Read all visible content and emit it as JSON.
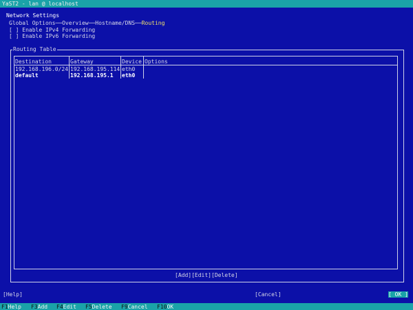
{
  "window": {
    "title": "YaST2 - lan @ localhost"
  },
  "dialog": {
    "title": "Network Settings",
    "tabs": [
      "Global Options",
      "Overview",
      "Hostname/DNS",
      "Routing"
    ],
    "tab_separators": [
      "──",
      "──",
      "──"
    ],
    "active_tab": "Routing"
  },
  "checkboxes": [
    {
      "mark": "[ ]",
      "label": "Enable IPv4 Forwarding",
      "checked": false
    },
    {
      "mark": "[ ]",
      "label": "Enable IPv6 Forwarding",
      "checked": false
    }
  ],
  "routing_table": {
    "title": "Routing Table",
    "columns": [
      "Destination",
      "Gateway",
      "Device",
      "Options"
    ],
    "rows": [
      {
        "destination": "192.168.196.0/24",
        "gateway": "192.168.195.114",
        "device": "eth0",
        "options": ""
      },
      {
        "destination": "default",
        "gateway": "192.168.195.1",
        "device": "eth0",
        "options": ""
      }
    ],
    "selected_row": 1,
    "buttons": {
      "add": "[Add]",
      "edit": "[Edit]",
      "delete": "[Delete]"
    }
  },
  "footer": {
    "help": "[Help]",
    "cancel": "[Cancel]",
    "ok": "[ OK ]"
  },
  "fkeys": [
    {
      "key": "F1",
      "label": "Help"
    },
    {
      "key": "F3",
      "label": "Add"
    },
    {
      "key": "F4",
      "label": "Edit"
    },
    {
      "key": "F5",
      "label": "Delete"
    },
    {
      "key": "F9",
      "label": "Cancel"
    },
    {
      "key": "F10",
      "label": "OK"
    }
  ],
  "colors": {
    "background": "#0c10a8",
    "accent": "#1aa3a8",
    "highlight_text": "#f4e46a",
    "frame": "#cfd2e8"
  }
}
